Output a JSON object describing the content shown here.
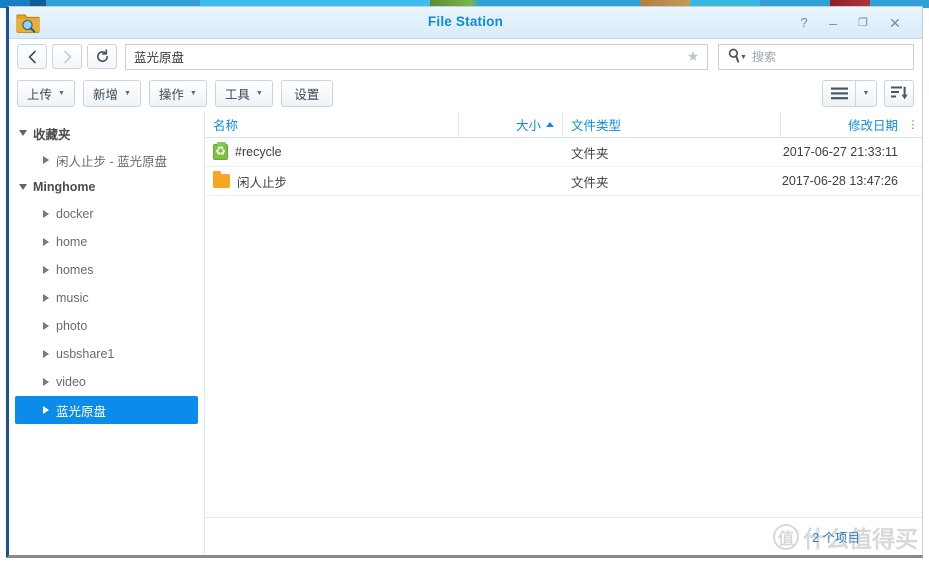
{
  "window": {
    "title": "File Station",
    "app_icon": "folder-search-icon",
    "controls": {
      "help": "?",
      "minimize": "–",
      "maximize": "❐",
      "close": "✕"
    }
  },
  "addressbar": {
    "back_icon": "chevron-left-icon",
    "forward_icon": "chevron-right-icon",
    "refresh_icon": "refresh-icon",
    "path": "蓝光原盘",
    "favorite_icon": "star-icon",
    "search_icon": "search-icon",
    "search_placeholder": "搜索",
    "search_value": ""
  },
  "toolbar": {
    "buttons": [
      {
        "label": "上传",
        "has_caret": true
      },
      {
        "label": "新增",
        "has_caret": true
      },
      {
        "label": "操作",
        "has_caret": true
      },
      {
        "label": "工具",
        "has_caret": true
      },
      {
        "label": "设置",
        "has_caret": false
      }
    ],
    "view_icon": "list-view-icon",
    "view_caret_icon": "chevron-down-icon",
    "sort_icon": "sort-descending-icon"
  },
  "sidebar": {
    "groups": [
      {
        "label": "收藏夹",
        "expanded": true,
        "items": [
          {
            "label": "闲人止步 - 蓝光原盘",
            "selected": false
          }
        ]
      },
      {
        "label": "Minghome",
        "expanded": true,
        "items": [
          {
            "label": "docker",
            "selected": false
          },
          {
            "label": "home",
            "selected": false
          },
          {
            "label": "homes",
            "selected": false
          },
          {
            "label": "music",
            "selected": false
          },
          {
            "label": "photo",
            "selected": false
          },
          {
            "label": "usbshare1",
            "selected": false
          },
          {
            "label": "video",
            "selected": false
          },
          {
            "label": "蓝光原盘",
            "selected": true
          }
        ]
      }
    ]
  },
  "filelist": {
    "columns": {
      "name": "名称",
      "size": "大小",
      "type": "文件类型",
      "date": "修改日期",
      "menu_icon": "column-options-icon"
    },
    "sort": {
      "column": "大小",
      "direction": "asc"
    },
    "rows": [
      {
        "icon": "recycle-bin-icon",
        "name": "#recycle",
        "size": "",
        "type": "文件夹",
        "date": "2017-06-27 21:33:11"
      },
      {
        "icon": "folder-icon",
        "name": "闲人止步",
        "size": "",
        "type": "文件夹",
        "date": "2017-06-28 13:47:26"
      }
    ]
  },
  "statusbar": {
    "count_text": "2 个项目"
  },
  "watermark": {
    "mark": "值",
    "text": "什么值得买"
  },
  "colors": {
    "accent": "#0b8bea",
    "title": "#0d8ad8",
    "selected_bg": "#0b8bea",
    "folder": "#f5a623",
    "recycle": "#7fc043"
  }
}
